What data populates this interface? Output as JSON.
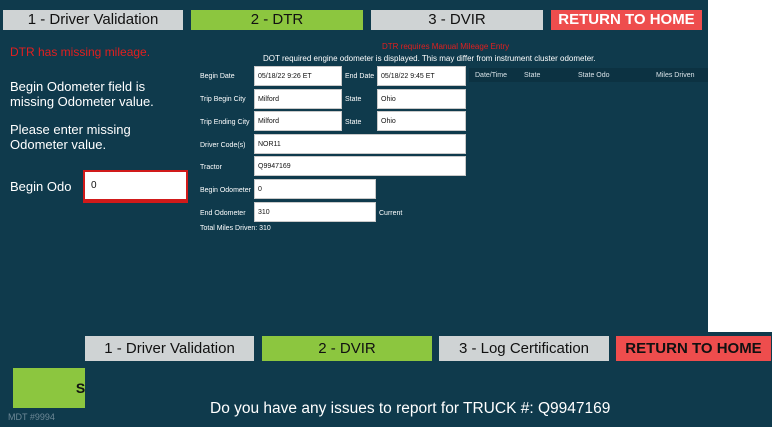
{
  "tabs": [
    {
      "label": "1 - Driver Validation"
    },
    {
      "label": "2 - DTR"
    },
    {
      "label": "3 - DVIR"
    },
    {
      "label": "RETURN TO HOME"
    }
  ],
  "left": {
    "error_title": "DTR has missing mileage.",
    "message1": "Begin Odometer field is missing Odometer value.",
    "message2": "Please enter missing Odometer value.",
    "begin_odo_label": "Begin Odo",
    "begin_odo_value": "0"
  },
  "notice": {
    "title": "DTR requires Manual Mileage Entry",
    "text": "DOT required engine odometer is displayed. This may differ from instrument cluster odometer."
  },
  "form": {
    "begin_date_label": "Begin Date",
    "begin_date": "05/18/22 9:26 ET",
    "end_date_label": "End Date",
    "end_date": "05/18/22 9:45 ET",
    "trip_begin_city_label": "Trip Begin City",
    "trip_begin_city": "Milford",
    "state_label_1": "State",
    "state_1": "Ohio",
    "trip_end_city_label": "Trip Ending City",
    "trip_end_city": "Milford",
    "state_label_2": "State",
    "state_2": "Ohio",
    "driver_codes_label": "Driver Code(s)",
    "driver_codes": "NOR11",
    "tractor_label": "Tractor",
    "tractor": "Q9947169",
    "begin_odometer_label": "Begin Odometer",
    "begin_odometer": "0",
    "end_odometer_label": "End Odometer",
    "end_odometer": "310",
    "current_label": "Current",
    "total_miles": "Total Miles Driven: 310"
  },
  "table": {
    "headers": [
      "Date/Time",
      "State",
      "State Odo",
      "Miles Driven"
    ]
  },
  "bottom_left": {
    "button_fragment": "S",
    "mdt_fragment": "MDT #9994"
  },
  "overlay": {
    "tabs": [
      {
        "label": "1 - Driver Validation"
      },
      {
        "label": "2 - DVIR"
      },
      {
        "label": "3 - Log Certification"
      },
      {
        "label": "RETURN TO HOME"
      }
    ],
    "question": "Do you have any issues to report for TRUCK #: Q9947169"
  },
  "colors": {
    "background": "#0f3a4c",
    "active_tab": "#8cc63f",
    "inactive_tab": "#cfd3d4",
    "home_tab": "#ee4d4d",
    "error_text": "#e21f1f"
  }
}
